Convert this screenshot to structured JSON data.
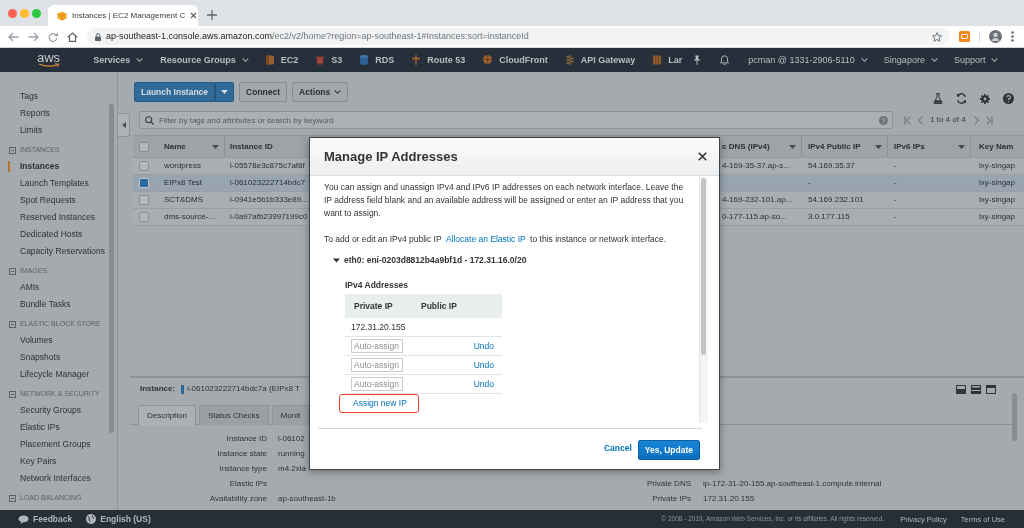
{
  "browser": {
    "tab_title": "Instances | EC2 Management C",
    "url_host": "ap-southeast-1.console.aws.amazon.com",
    "url_path": "/ec2/v2/home?region=ap-southeast-1#Instances:sort=instanceId"
  },
  "nav": {
    "logo": "aws",
    "menus": [
      "Services",
      "Resource Groups"
    ],
    "shortcuts": [
      {
        "label": "EC2",
        "kind": "compute"
      },
      {
        "label": "S3",
        "kind": "storage"
      },
      {
        "label": "RDS",
        "kind": "database"
      },
      {
        "label": "Route 53",
        "kind": "dns"
      },
      {
        "label": "CloudFront",
        "kind": "cdn"
      },
      {
        "label": "API Gateway",
        "kind": "api"
      },
      {
        "label": "Lar",
        "kind": "function"
      }
    ],
    "account": "pcman @ 1331-2906-5110",
    "region": "Singapore",
    "support": "Support"
  },
  "sidebar": {
    "groups": [
      {
        "items": [
          {
            "label": "Tags",
            "selected": false
          },
          {
            "label": "Reports",
            "selected": false
          },
          {
            "label": "Limits",
            "selected": false
          }
        ]
      },
      {
        "title": "INSTANCES",
        "expanded": true,
        "items": [
          {
            "label": "Instances",
            "selected": true
          },
          {
            "label": "Launch Templates",
            "selected": false
          },
          {
            "label": "Spot Requests",
            "selected": false
          },
          {
            "label": "Reserved Instances",
            "selected": false
          },
          {
            "label": "Dedicated Hosts",
            "selected": false
          },
          {
            "label": "Capacity Reservations",
            "selected": false
          }
        ]
      },
      {
        "title": "IMAGES",
        "expanded": true,
        "items": [
          {
            "label": "AMIs",
            "selected": false
          },
          {
            "label": "Bundle Tasks",
            "selected": false
          }
        ]
      },
      {
        "title": "ELASTIC BLOCK STORE",
        "expanded": true,
        "items": [
          {
            "label": "Volumes",
            "selected": false
          },
          {
            "label": "Snapshots",
            "selected": false
          },
          {
            "label": "Lifecycle Manager",
            "selected": false
          }
        ]
      },
      {
        "title": "NETWORK & SECURITY",
        "expanded": true,
        "items": [
          {
            "label": "Security Groups",
            "selected": false
          },
          {
            "label": "Elastic IPs",
            "selected": false
          },
          {
            "label": "Placement Groups",
            "selected": false
          },
          {
            "label": "Key Pairs",
            "selected": false
          },
          {
            "label": "Network Interfaces",
            "selected": false
          }
        ]
      },
      {
        "title": "LOAD BALANCING",
        "expanded": true
      }
    ]
  },
  "toolbar": {
    "launch": "Launch Instance",
    "connect": "Connect",
    "actions": "Actions"
  },
  "filter": {
    "placeholder": "Filter by tags and attributes or search by keyword",
    "pagination": "1 to 4 of 4"
  },
  "table": {
    "all_selected": false,
    "columns": [
      {
        "label": "Name",
        "caret": true
      },
      {
        "label": "Instance ID",
        "caret": false
      },
      {
        "label": "c DNS (IPv4)",
        "caret": true
      },
      {
        "label": "IPv4 Public IP",
        "caret": true
      },
      {
        "label": "IPv6 IPs",
        "caret": true
      },
      {
        "label": "Key Nam",
        "caret": false
      }
    ],
    "rows": [
      {
        "selected": false,
        "cells": [
          "wordpress",
          "i-05578e3c875c7af8f",
          "4-169-35-37.ap-s...",
          "54.169.35.37",
          "-",
          "lxy-singap"
        ]
      },
      {
        "selected": true,
        "cells": [
          "EIPx8 Test",
          "i-061023222714bdc7",
          null,
          "-",
          "-",
          "lxy-singap"
        ]
      },
      {
        "selected": false,
        "cells": [
          "SCT&DMS",
          "i-0941e5b1b333e89...",
          "4-169-232-101.ap...",
          "54.169.232.101",
          "-",
          "lxy-singap"
        ]
      },
      {
        "selected": false,
        "cells": [
          "dms-source-...",
          "i-0a97afb23997199c0",
          "0-177-115.ap-so...",
          "3.0.177.115",
          "-",
          "lxy-singap"
        ]
      }
    ]
  },
  "details": {
    "label": "Instance:",
    "instance": "i-061023222714bdc7a (EIPx8 T",
    "tabs": [
      {
        "label": "Description",
        "selected": true
      },
      {
        "label": "Status Checks",
        "selected": false
      },
      {
        "label": "Monit",
        "selected": false
      }
    ],
    "fields": [
      {
        "label": "Instance ID",
        "value": "i-06102"
      },
      {
        "label": "Instance state",
        "value": "running"
      },
      {
        "label": "Instance type",
        "value": "m4.2xla"
      },
      {
        "label": "Elastic IPs"
      },
      {
        "label": "Availability zone",
        "value": "ap-southeast-1b"
      }
    ],
    "fields_right": [
      {
        "label": "Private DNS",
        "value": "ip-172-31-20-155.ap-southeast-1.compute.internal"
      },
      {
        "label": "Private IPs",
        "value": "172.31.20.155"
      }
    ]
  },
  "footer": {
    "feedback": "Feedback",
    "language": "English (US)",
    "copyright": "© 2008 - 2019, Amazon Web Services, Inc. or its affiliates. All rights reserved.",
    "links": [
      "Privacy Policy",
      "Terms of Use"
    ]
  },
  "modal": {
    "title": "Manage IP Addresses",
    "intro": "You can assign and unassign IPv4 and IPv6 IP addresses on each network interface. Leave the IP address field blank and an available address will be assigned or enter an IP address that you want to assign.",
    "note": {
      "before": "To add or edit an IPv4 public IP ",
      "link": "Allocate an Elastic IP",
      "after": " to this instance or network interface."
    },
    "interface": {
      "label": "eth0: eni-0203d8812b4a9bf1d - 172.31.16.0/20",
      "expanded": true
    },
    "heading": "IPv4 Addresses",
    "columns": [
      "Private IP",
      "Public IP"
    ],
    "rows": [
      {
        "kind": "address",
        "private_ip": "172.31.20.155"
      },
      {
        "kind": "new",
        "placeholder": "Auto-assign",
        "action": "Undo"
      },
      {
        "kind": "new",
        "placeholder": "Auto-assign",
        "action": "Undo"
      },
      {
        "kind": "new",
        "placeholder": "Auto-assign",
        "action": "Undo"
      }
    ],
    "assign": {
      "label": "Assign new IP",
      "highlighted": true
    },
    "cancel": "Cancel",
    "confirm": "Yes, Update"
  }
}
